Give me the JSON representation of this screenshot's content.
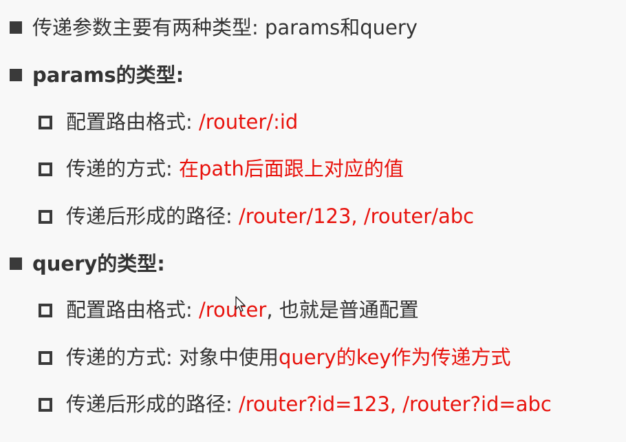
{
  "colors": {
    "text": "#333333",
    "highlight": "#e8120c",
    "background": "#f8f8f8"
  },
  "items": [
    {
      "level": 1,
      "text": "传递参数主要有两种类型: params和query"
    },
    {
      "level": 1,
      "text": "params的类型:"
    },
    {
      "level": 2,
      "label": "配置路由格式: ",
      "value": "/router/:id"
    },
    {
      "level": 2,
      "label": "传递的方式: ",
      "value": "在path后面跟上对应的值"
    },
    {
      "level": 2,
      "label": "传递后形成的路径: ",
      "value": "/router/123, /router/abc"
    },
    {
      "level": 1,
      "text": "query的类型:"
    },
    {
      "level": 2,
      "label": "配置路由格式: ",
      "value": "/router",
      "suffix": ", 也就是普通配置"
    },
    {
      "level": 2,
      "label": "传递的方式: 对象中使用",
      "value": "query的key作为传递方式"
    },
    {
      "level": 2,
      "label": "传递后形成的路径: ",
      "value": "/router?id=123, /router?id=abc"
    }
  ],
  "icons": {
    "level1_bullet": "square-filled-icon",
    "level2_bullet": "square-outline-icon",
    "mouse": "mouse-pointer-icon"
  }
}
